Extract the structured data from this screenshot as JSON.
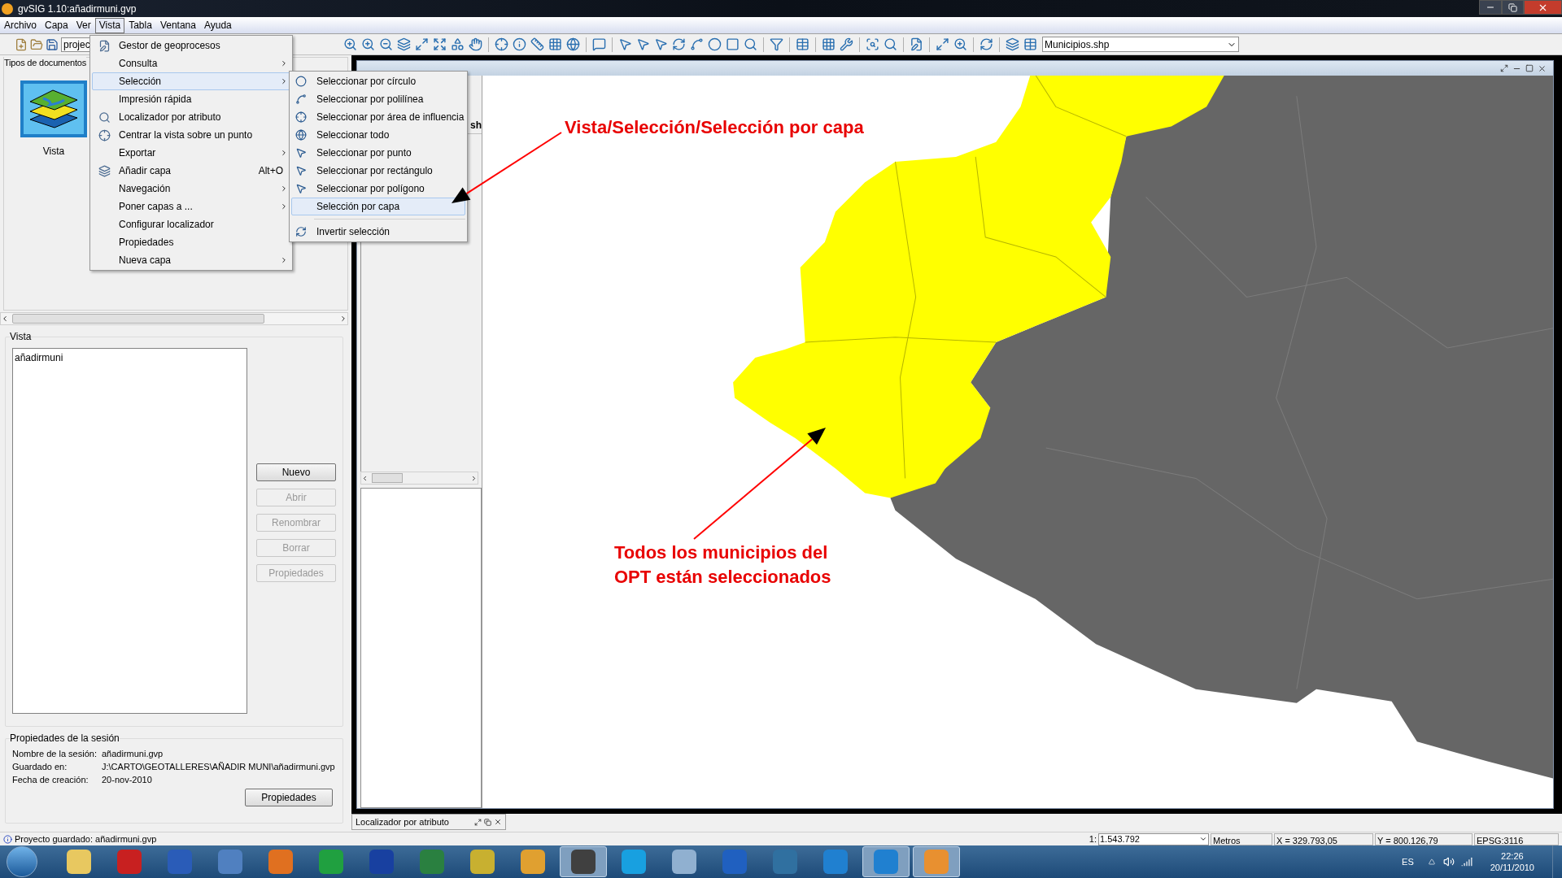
{
  "window": {
    "title": "gvSIG 1.10:añadirmuni.gvp"
  },
  "menu_bar": [
    {
      "label": "Archivo",
      "selected": false
    },
    {
      "label": "Capa",
      "selected": false
    },
    {
      "label": "Ver",
      "selected": false
    },
    {
      "label": "Vista",
      "selected": true
    },
    {
      "label": "Tabla",
      "selected": false
    },
    {
      "label": "Ventana",
      "selected": false
    },
    {
      "label": "Ayuda",
      "selected": false
    }
  ],
  "toolbar": {
    "project_field": "projec",
    "layer_combo": "Municipios.shp"
  },
  "vista_menu": [
    {
      "label": "Gestor de geoprocesos",
      "submenu": false,
      "highlighted": false
    },
    {
      "label": "Consulta",
      "submenu": true,
      "highlighted": false
    },
    {
      "label": "Selección",
      "submenu": true,
      "highlighted": true
    },
    {
      "label": "Impresión rápida",
      "submenu": false,
      "highlighted": false
    },
    {
      "label": "Localizador por atributo",
      "submenu": false,
      "highlighted": false
    },
    {
      "label": "Centrar la vista sobre un punto",
      "submenu": false,
      "highlighted": false
    },
    {
      "label": "Exportar",
      "submenu": true,
      "highlighted": false
    },
    {
      "label": "Añadir capa",
      "shortcut": "Alt+O",
      "submenu": false,
      "highlighted": false
    },
    {
      "label": "Navegación",
      "submenu": true,
      "highlighted": false
    },
    {
      "label": "Poner capas a ...",
      "submenu": true,
      "highlighted": false
    },
    {
      "label": "Configurar localizador",
      "submenu": false,
      "highlighted": false
    },
    {
      "label": "Propiedades",
      "submenu": false,
      "highlighted": false
    },
    {
      "label": "Nueva capa",
      "submenu": true,
      "highlighted": false
    }
  ],
  "selection_submenu": [
    {
      "kind": "item",
      "label": "Seleccionar por círculo",
      "highlighted": false
    },
    {
      "kind": "item",
      "label": "Seleccionar por polilínea",
      "highlighted": false
    },
    {
      "kind": "item",
      "label": "Seleccionar por área de influencia",
      "highlighted": false
    },
    {
      "kind": "item",
      "label": "Seleccionar todo",
      "highlighted": false
    },
    {
      "kind": "item",
      "label": "Seleccionar por punto",
      "highlighted": false
    },
    {
      "kind": "item",
      "label": "Seleccionar por rectángulo",
      "highlighted": false
    },
    {
      "kind": "item",
      "label": "Seleccionar por polígono",
      "highlighted": false
    },
    {
      "kind": "item",
      "label": "Selección por capa",
      "highlighted": true
    },
    {
      "kind": "separator"
    },
    {
      "kind": "item",
      "label": "Invertir selección",
      "highlighted": false
    }
  ],
  "documents_panel": {
    "title": "Tipos de documentos",
    "types": [
      {
        "label": "Vista"
      }
    ]
  },
  "vista_group": {
    "title": "Vista",
    "items": [
      "añadirmuni"
    ],
    "buttons": [
      {
        "label": "Nuevo",
        "disabled": false
      },
      {
        "label": "Abrir",
        "disabled": true
      },
      {
        "label": "Renombrar",
        "disabled": true
      },
      {
        "label": "Borrar",
        "disabled": true
      },
      {
        "label": "Propiedades",
        "disabled": true
      }
    ]
  },
  "session": {
    "title": "Propiedades de la sesión",
    "fields": [
      {
        "label": "Nombre de la sesión:",
        "value": "añadirmuni.gvp"
      },
      {
        "label": "Guardado en:",
        "value": "J:\\CARTO\\GEOTALLERES\\AÑADIR MUNI\\añadirmuni.gvp"
      },
      {
        "label": "Fecha de creación:",
        "value": "20-nov-2010"
      }
    ],
    "button": "Propiedades"
  },
  "view_window": {
    "toc_fragment": "sh"
  },
  "annotations": [
    {
      "lines": [
        "Vista/Selección/Selección por capa"
      ]
    },
    {
      "lines": [
        "Todos los municipios del",
        "OPT están seleccionados"
      ]
    }
  ],
  "locator_panel": {
    "title": "Localizador por atributo"
  },
  "status_bar": {
    "message": "Proyecto guardado: añadirmuni.gvp",
    "scale_prefix": "1:",
    "scale": "1.543.792",
    "units": "Metros",
    "x": "X = 329.793,05",
    "y": "Y = 800.126,79",
    "crs": "EPSG:3116"
  },
  "taskbar": {
    "apps": [
      {
        "active": false
      },
      {
        "active": false
      },
      {
        "active": false
      },
      {
        "active": false
      },
      {
        "active": false
      },
      {
        "active": false
      },
      {
        "active": false
      },
      {
        "active": false
      },
      {
        "active": false
      },
      {
        "active": false
      },
      {
        "active": true
      },
      {
        "active": false
      },
      {
        "active": false
      },
      {
        "active": false
      },
      {
        "active": false
      },
      {
        "active": false
      },
      {
        "active": true
      },
      {
        "active": true
      }
    ],
    "language": "ES",
    "time": "22:26",
    "date": "20/11/2010"
  }
}
